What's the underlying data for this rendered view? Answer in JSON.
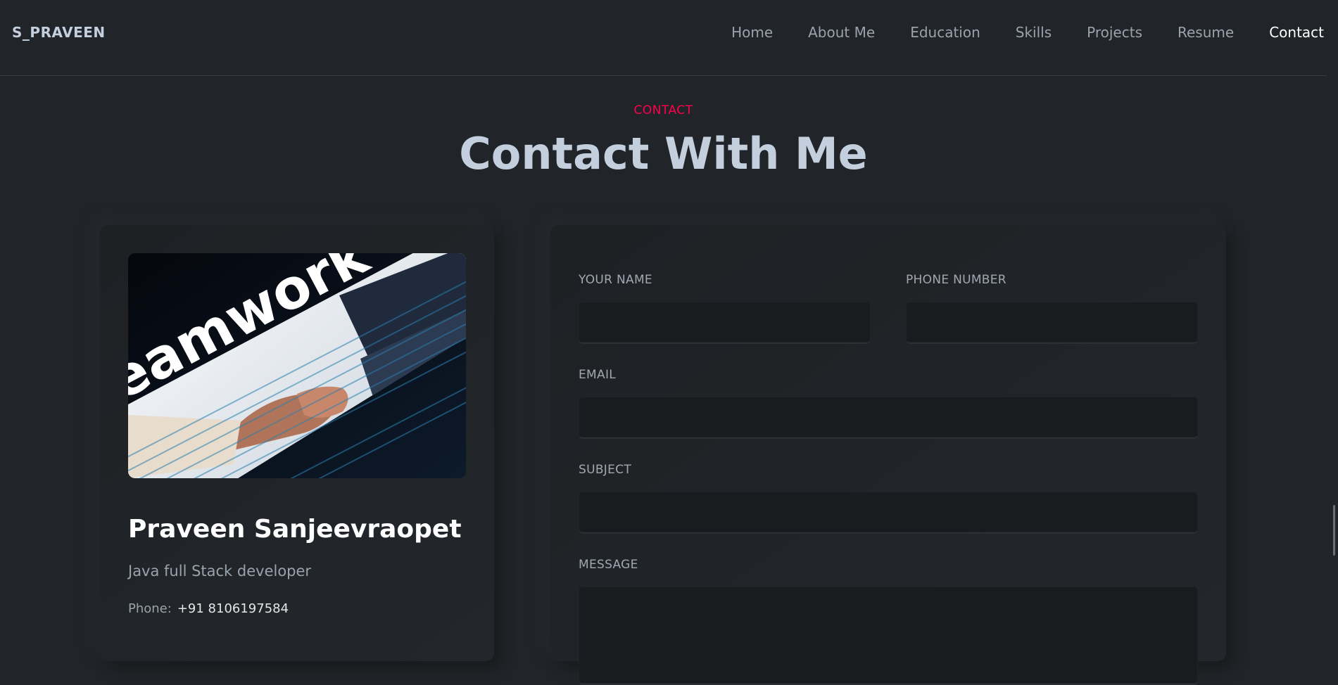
{
  "brand": "S_PRAVEEN",
  "nav": {
    "items": [
      {
        "label": "Home",
        "active": false
      },
      {
        "label": "About Me",
        "active": false
      },
      {
        "label": "Education",
        "active": false
      },
      {
        "label": "Skills",
        "active": false
      },
      {
        "label": "Projects",
        "active": false
      },
      {
        "label": "Resume",
        "active": false
      },
      {
        "label": "Contact",
        "active": true
      }
    ]
  },
  "section": {
    "kicker": "CONTACT",
    "title": "Contact With Me"
  },
  "profile": {
    "image_text": "eamwork",
    "name": "Praveen Sanjeevraopet",
    "role": "Java full Stack developer",
    "phone_label": "Phone:",
    "phone_value": "+91 8106197584"
  },
  "form": {
    "name_label": "YOUR NAME",
    "name_value": "",
    "phone_label": "PHONE NUMBER",
    "phone_value": "",
    "email_label": "EMAIL",
    "email_value": "",
    "subject_label": "SUBJECT",
    "subject_value": "",
    "message_label": "MESSAGE",
    "message_value": ""
  },
  "colors": {
    "background": "#212428",
    "accent": "#ff014f",
    "text": "#c4cfde"
  }
}
